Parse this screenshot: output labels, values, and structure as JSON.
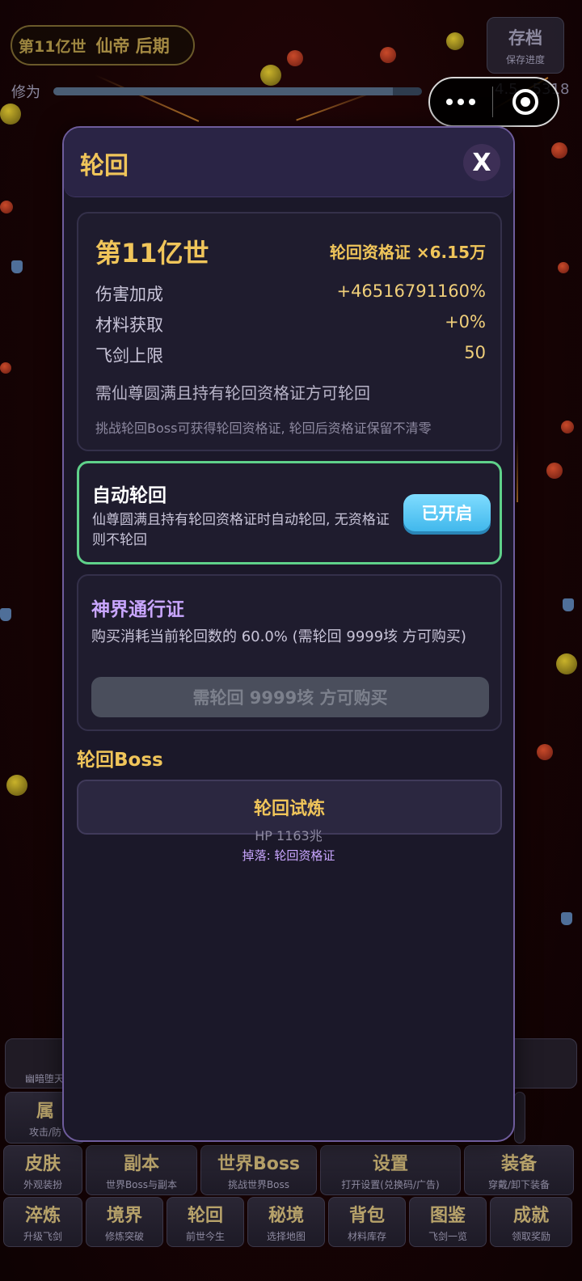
{
  "hud": {
    "generation": "第11亿世",
    "realm": "仙帝 后期",
    "save": {
      "title": "存档",
      "subtitle": "保存进度"
    },
    "cultivation": {
      "label": "修为",
      "value": "4.5…5318",
      "progress": 0.92
    }
  },
  "modal": {
    "title": "轮回",
    "close_label": "X",
    "status": {
      "generation": "第11亿世",
      "certificate": "轮回资格证 ×6.15万",
      "stats": [
        {
          "label": "伤害加成",
          "value": "+46516791160%"
        },
        {
          "label": "材料获取",
          "value": "+0%"
        },
        {
          "label": "飞剑上限",
          "value": "50"
        }
      ],
      "requirement": "需仙尊圆满且持有轮回资格证方可轮回",
      "hint": "挑战轮回Boss可获得轮回资格证, 轮回后资格证保留不清零"
    },
    "auto_reincarnation": {
      "title": "自动轮回",
      "description": "仙尊圆满且持有轮回资格证时自动轮回, 无资格证则不轮回",
      "toggle_label": "已开启"
    },
    "divine_pass": {
      "title": "神界通行证",
      "description": "购买消耗当前轮回数的 60.0% (需轮回 9999垓 方可购买)",
      "button_label": "需轮回 9999垓 方可购买"
    },
    "boss": {
      "section_title": "轮回Boss",
      "button_label": "轮回试炼",
      "hp": "HP 1163兆",
      "drop": "掉落: 轮回资格证"
    }
  },
  "bottom_menu": {
    "row1": [
      {
        "title": "皮肤",
        "subtitle": "外观装扮"
      },
      {
        "title": "副本",
        "subtitle": "世界Boss与副本"
      },
      {
        "title": "世界Boss",
        "subtitle": "挑战世界Boss"
      },
      {
        "title": "设置",
        "subtitle": "打开设置(兑换码/广告)"
      },
      {
        "title": "装备",
        "subtitle": "穿戴/卸下装备"
      }
    ],
    "row2": [
      {
        "title": "淬炼",
        "subtitle": "升级飞剑"
      },
      {
        "title": "境界",
        "subtitle": "修炼突破"
      },
      {
        "title": "轮回",
        "subtitle": "前世今生"
      },
      {
        "title": "秘境",
        "subtitle": "选择地图"
      },
      {
        "title": "背包",
        "subtitle": "材料库存"
      },
      {
        "title": "图鉴",
        "subtitle": "飞剑一览"
      },
      {
        "title": "成就",
        "subtitle": "领取奖励"
      }
    ],
    "partial_left": {
      "title": "属",
      "subtitle": "攻击/防",
      "top_text": "幽暗堕天"
    }
  }
}
